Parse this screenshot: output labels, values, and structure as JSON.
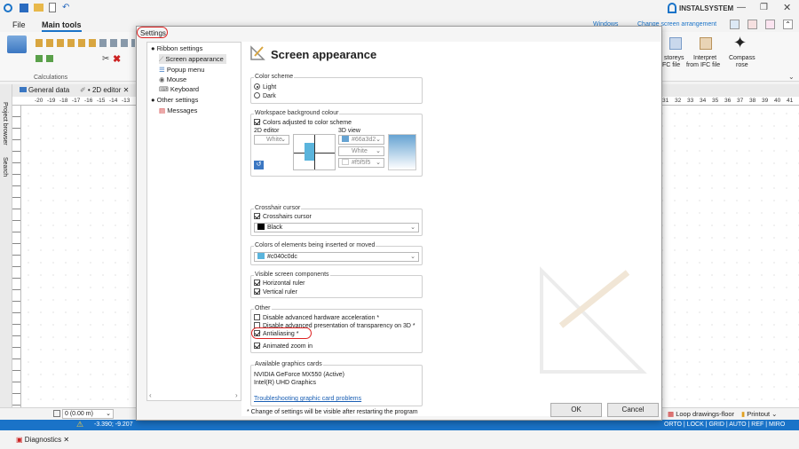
{
  "app": {
    "brand": "INSTALSYSTEM",
    "menu": {
      "file": "File",
      "main_tools": "Main tools"
    },
    "ribbon": {
      "calculations": "Calculations",
      "windows": "Windows",
      "change_arrangement": "Change screen arrangement",
      "storeys": "storeys",
      "ifc_file": "IFC file",
      "interpret": "Interpret",
      "from_ifc": "from IFC file",
      "compass": "Compass",
      "rose": "rose"
    },
    "doc_tabs": {
      "general_data": "General data",
      "editor_2d": "2D editor"
    },
    "side_panels": {
      "project_browser": "Project browser",
      "search": "Search"
    },
    "ruler_left": [
      "-20",
      "-19",
      "-18",
      "-17",
      "-16",
      "-15",
      "-14",
      "-13"
    ],
    "ruler_right": [
      "31",
      "32",
      "33",
      "34",
      "35",
      "36",
      "37",
      "38",
      "39",
      "40",
      "41"
    ],
    "level_combo": "0 (0.00 m)",
    "loop_drawings": "Loop drawings-floor",
    "printout": "Printout",
    "status": {
      "coords": "-3.390; -9.207",
      "modes": "ORTO | LOCK | GRID | AUTO | REF | MIRO"
    },
    "diagnostics": "Diagnostics"
  },
  "dialog": {
    "title": "Settings",
    "tree": [
      {
        "label": "Ribbon settings",
        "kind": "bullet"
      },
      {
        "label": "Screen appearance",
        "kind": "icon",
        "selected": true
      },
      {
        "label": "Popup menu",
        "kind": "icon"
      },
      {
        "label": "Mouse",
        "kind": "icon"
      },
      {
        "label": "Keyboard",
        "kind": "icon"
      },
      {
        "label": "Other settings",
        "kind": "bullet"
      },
      {
        "label": "Messages",
        "kind": "icon"
      }
    ],
    "heading": "Screen appearance",
    "color_scheme": {
      "label": "Color scheme",
      "light": "Light",
      "dark": "Dark"
    },
    "workspace": {
      "label": "Workspace background colour",
      "adjusted": "Colors adjusted to color scheme",
      "editor_2d": "2D editor",
      "view_3d": "3D view",
      "color_2d": "White",
      "color_3d_1": "#66a3d2",
      "color_3d_2": "White",
      "color_3d_3": "#f5f5f5"
    },
    "crosshair": {
      "label": "Crosshair cursor",
      "cb": "Crosshairs cursor",
      "color": "Black"
    },
    "inserted": {
      "label": "Colors of elements being inserted or moved",
      "color": "#c040c0dc"
    },
    "visible": {
      "label": "Visible screen components",
      "h_ruler": "Horizontal ruler",
      "v_ruler": "Vertical ruler"
    },
    "other": {
      "label": "Other",
      "hw_accel": "Disable advanced hardware acceleration *",
      "transparency": "Disable advanced presentation of transparency on 3D *",
      "antialiasing": "Antialiasing *",
      "animated_zoom": "Animated zoom in"
    },
    "graphics": {
      "label": "Available graphics cards",
      "card1": "NVIDIA GeForce MX550 (Active)",
      "card2": "Intel(R) UHD Graphics",
      "link": "Troubleshooting graphic card problems"
    },
    "note": "* Change of settings will be visible after restarting the program",
    "ok": "OK",
    "cancel": "Cancel"
  },
  "colors": {
    "accent": "#1a73c8",
    "highlight_ring": "#dd2222",
    "color_3d_swatch": "#66a3d2",
    "inserted_swatch": "#5ab4dc"
  }
}
